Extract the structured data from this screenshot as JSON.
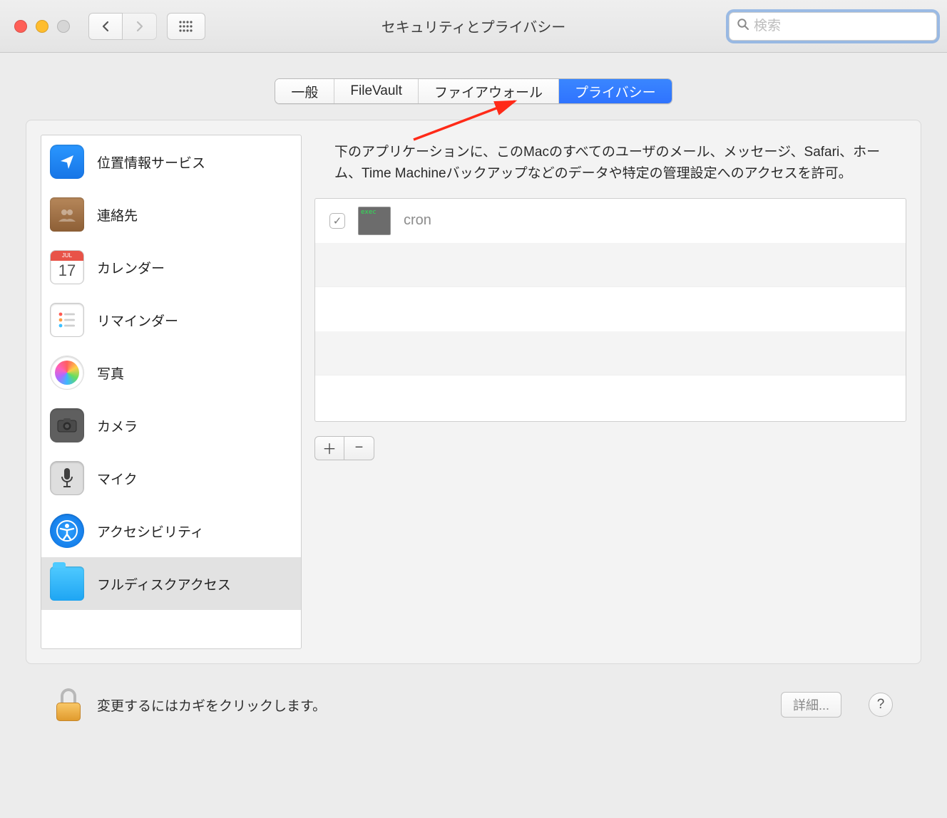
{
  "window": {
    "title": "セキュリティとプライバシー",
    "search_placeholder": "検索"
  },
  "tabs": [
    {
      "label": "一般",
      "active": false
    },
    {
      "label": "FileVault",
      "active": false
    },
    {
      "label": "ファイアウォール",
      "active": false
    },
    {
      "label": "プライバシー",
      "active": true
    }
  ],
  "sidebar": {
    "items": [
      {
        "label": "位置情報サービス",
        "icon": "location"
      },
      {
        "label": "連絡先",
        "icon": "contacts"
      },
      {
        "label": "カレンダー",
        "icon": "calendar",
        "day": "17",
        "month": "JUL"
      },
      {
        "label": "リマインダー",
        "icon": "reminders"
      },
      {
        "label": "写真",
        "icon": "photos"
      },
      {
        "label": "カメラ",
        "icon": "camera"
      },
      {
        "label": "マイク",
        "icon": "mic"
      },
      {
        "label": "アクセシビリティ",
        "icon": "accessibility"
      },
      {
        "label": "フルディスクアクセス",
        "icon": "folder",
        "selected": true
      }
    ]
  },
  "detail": {
    "description": "下のアプリケーションに、このMacのすべてのユーザのメール、メッセージ、Safari、ホーム、Time Machineバックアップなどのデータや特定の管理設定へのアクセスを許可。",
    "apps": [
      {
        "name": "cron",
        "checked": true,
        "tag": "exec"
      }
    ]
  },
  "footer": {
    "lock_text": "変更するにはカギをクリックします。",
    "detail_btn": "詳細...",
    "help": "?"
  }
}
